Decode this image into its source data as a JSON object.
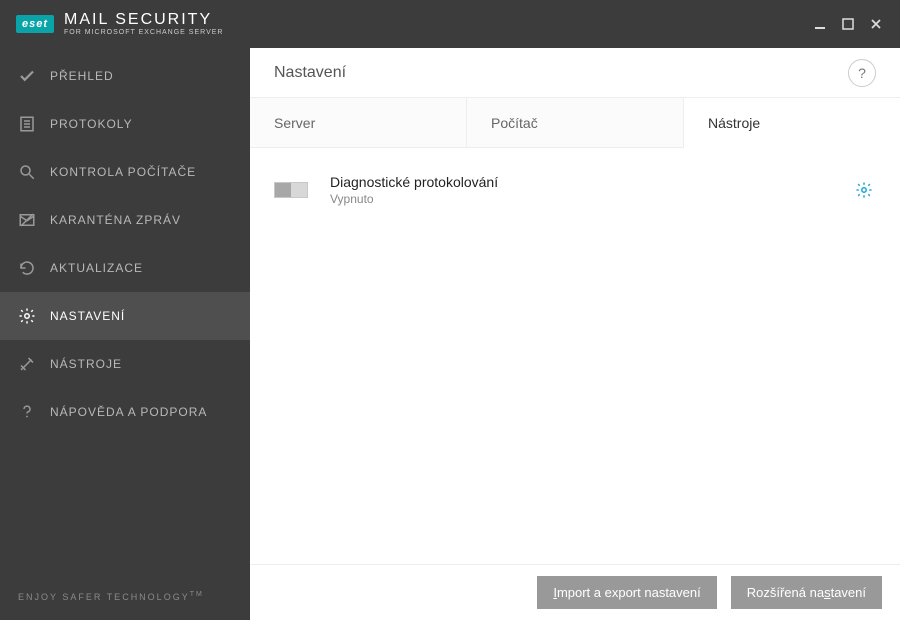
{
  "titlebar": {
    "brand_badge": "eset",
    "brand_title": "MAIL SECURITY",
    "brand_subtitle": "FOR MICROSOFT EXCHANGE SERVER"
  },
  "sidebar": {
    "items": [
      {
        "label": "PŘEHLED",
        "icon": "check-icon"
      },
      {
        "label": "PROTOKOLY",
        "icon": "list-icon"
      },
      {
        "label": "KONTROLA POČÍTAČE",
        "icon": "search-icon"
      },
      {
        "label": "KARANTÉNA ZPRÁV",
        "icon": "envelope-blocked-icon"
      },
      {
        "label": "AKTUALIZACE",
        "icon": "refresh-icon"
      },
      {
        "label": "NASTAVENÍ",
        "icon": "gear-icon"
      },
      {
        "label": "NÁSTROJE",
        "icon": "tools-icon"
      },
      {
        "label": "NÁPOVĚDA A PODPORA",
        "icon": "help-icon"
      }
    ],
    "active_index": 5,
    "footer": "ENJOY SAFER TECHNOLOGY",
    "footer_tm": "TM"
  },
  "page": {
    "title": "Nastavení",
    "help_label": "?"
  },
  "tabs": {
    "items": [
      {
        "label": "Server"
      },
      {
        "label": "Počítač"
      },
      {
        "label": "Nástroje"
      }
    ],
    "active_index": 2
  },
  "settings": {
    "diag_logging": {
      "title": "Diagnostické protokolování",
      "status": "Vypnuto",
      "enabled": false
    }
  },
  "footer": {
    "import_export_prefix": "I",
    "import_export_rest": "mport a export nastavení",
    "advanced_prefix": "Rozšířená na",
    "advanced_underline": "s",
    "advanced_rest": "tavení"
  }
}
